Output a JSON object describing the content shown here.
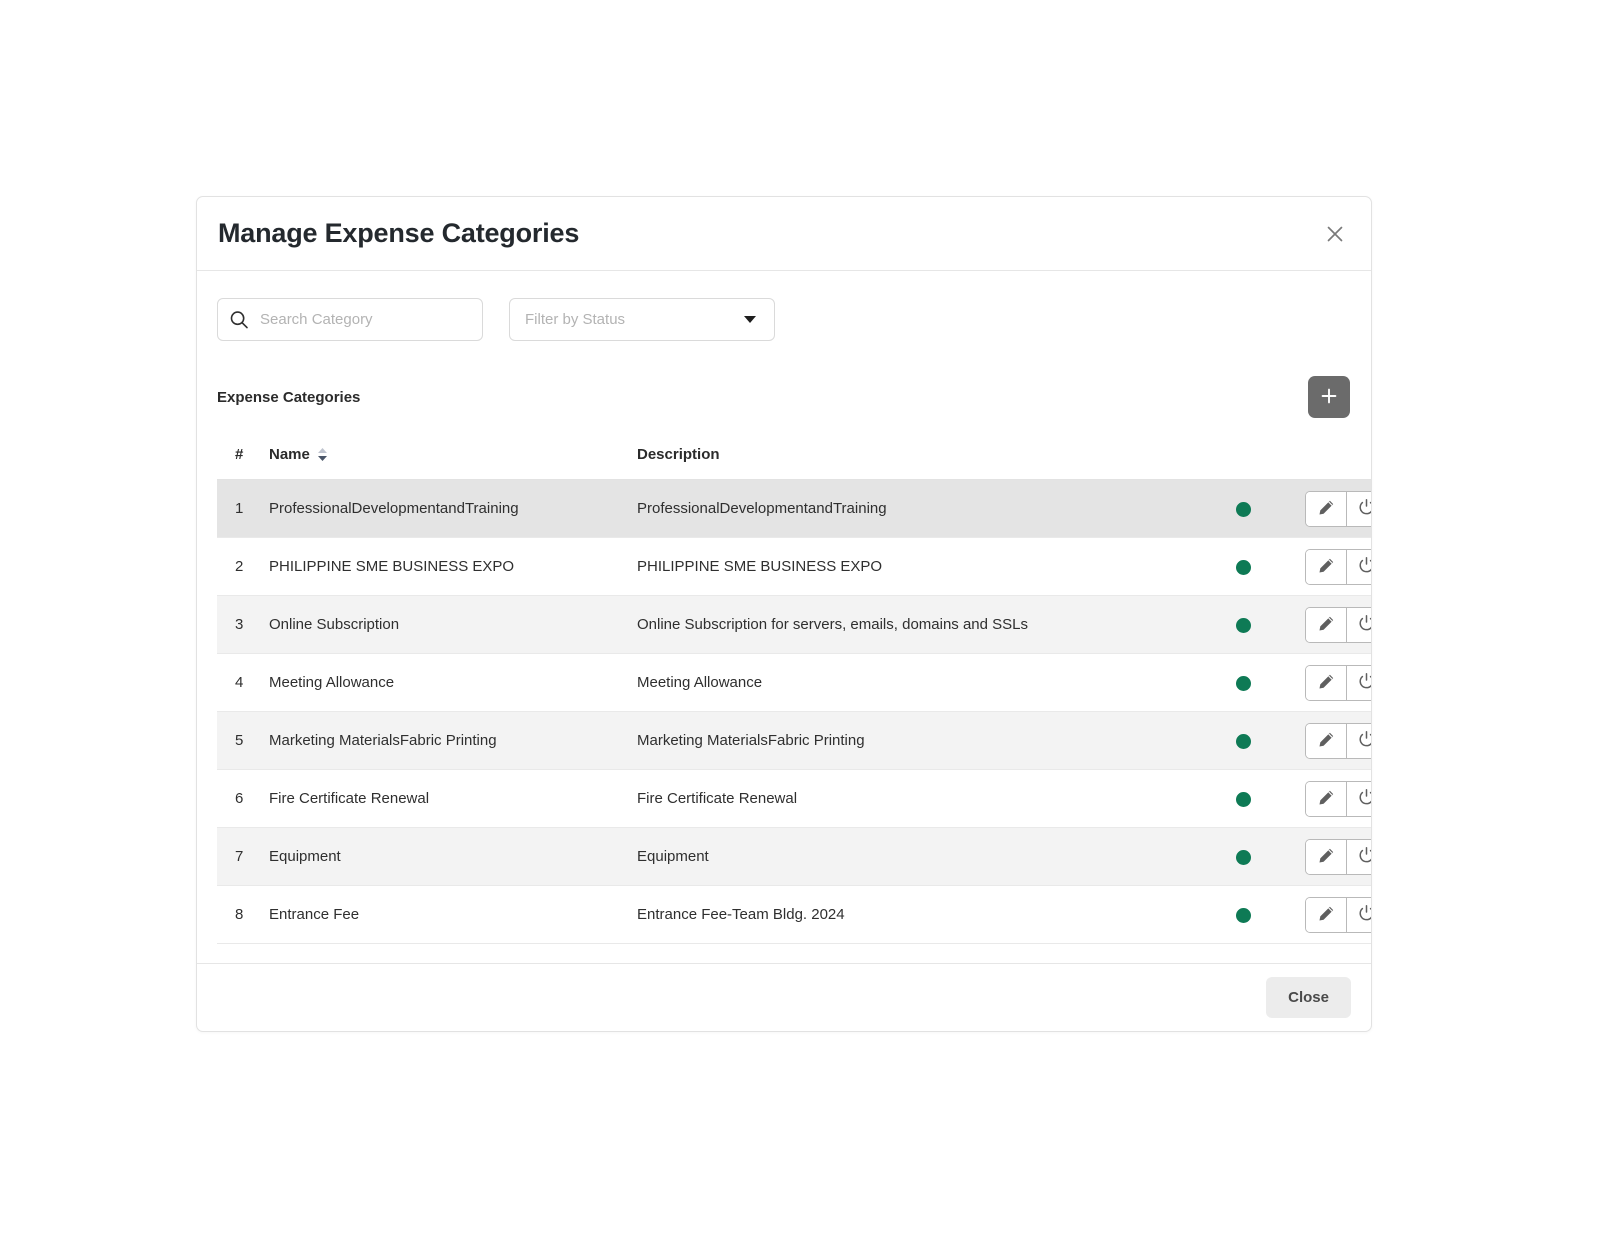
{
  "dialog": {
    "title": "Manage Expense Categories",
    "close_icon": "close-icon"
  },
  "filters": {
    "search": {
      "placeholder": "Search Category",
      "value": "",
      "icon": "search-icon"
    },
    "status_select": {
      "placeholder": "Filter by Status",
      "value": "Filter by Status",
      "icon": "chevron-down-icon",
      "options": [
        "Filter by Status"
      ]
    }
  },
  "section": {
    "title": "Expense Categories",
    "add_button_icon": "plus-icon",
    "add_button_label": "+"
  },
  "table": {
    "columns": {
      "num": "#",
      "name": "Name",
      "description": "Description",
      "status": "",
      "actions": ""
    },
    "sort_icon": "sort-updown-icon",
    "row_actions": {
      "edit_icon": "pencil-icon",
      "toggle_icon": "power-icon"
    },
    "status_color": "#0e7a55",
    "rows": [
      {
        "num": "1",
        "name": "ProfessionalDevelopmentandTraining",
        "description": "ProfessionalDevelopmentandTraining",
        "status": "active"
      },
      {
        "num": "2",
        "name": "PHILIPPINE SME BUSINESS EXPO",
        "description": "PHILIPPINE SME BUSINESS EXPO",
        "status": "active"
      },
      {
        "num": "3",
        "name": "Online Subscription",
        "description": "Online Subscription for servers, emails, domains and SSLs",
        "status": "active"
      },
      {
        "num": "4",
        "name": "Meeting Allowance",
        "description": "Meeting Allowance",
        "status": "active"
      },
      {
        "num": "5",
        "name": "Marketing MaterialsFabric Printing",
        "description": "Marketing MaterialsFabric Printing",
        "status": "active"
      },
      {
        "num": "6",
        "name": "Fire Certificate Renewal",
        "description": "Fire Certificate Renewal",
        "status": "active"
      },
      {
        "num": "7",
        "name": "Equipment",
        "description": "Equipment",
        "status": "active"
      },
      {
        "num": "8",
        "name": "Entrance Fee",
        "description": "Entrance Fee-Team Bldg. 2024",
        "status": "active"
      }
    ]
  },
  "footer": {
    "close_label": "Close"
  }
}
